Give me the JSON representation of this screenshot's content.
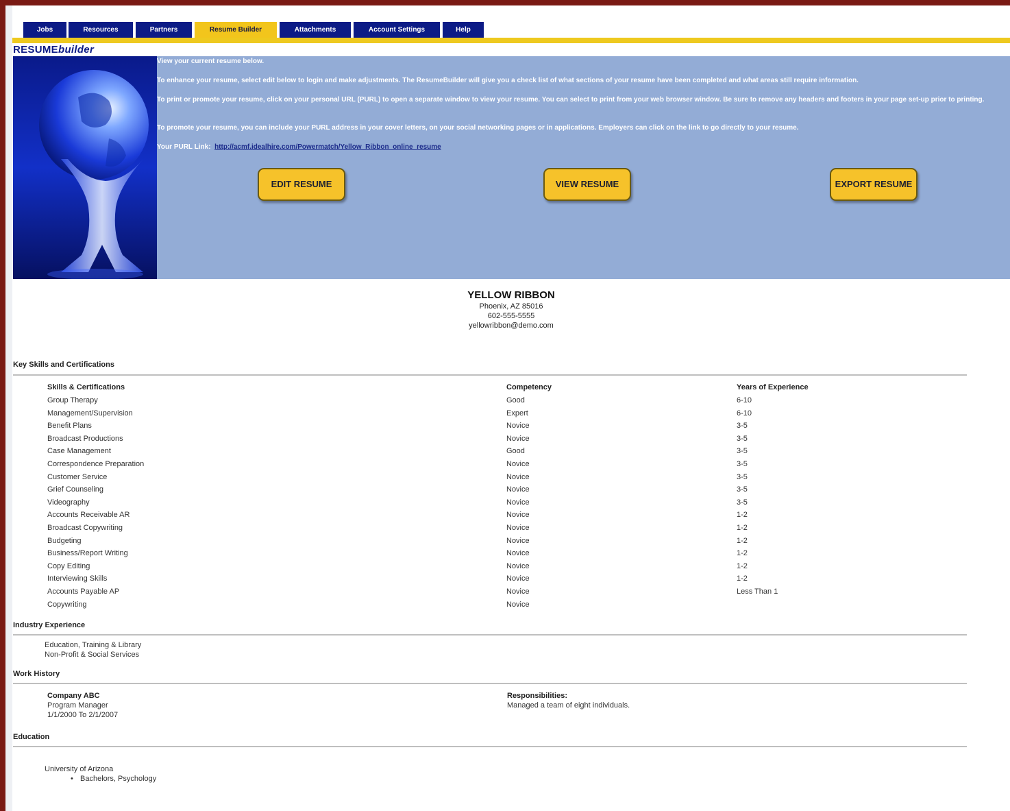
{
  "nav": {
    "tabs": [
      {
        "label": "Jobs"
      },
      {
        "label": "Resources"
      },
      {
        "label": "Partners"
      },
      {
        "label": "Resume Builder",
        "active": true
      },
      {
        "label": "Attachments"
      },
      {
        "label": "Account Settings"
      },
      {
        "label": "Help"
      }
    ]
  },
  "logo": {
    "resume": "RESUME",
    "builder": "builder"
  },
  "hero": {
    "p1": "View your current resume below.",
    "p2": "To enhance your resume, select edit below to login and make adjustments. The ResumeBuilder will give you a check list of what sections of your resume have been completed and what areas still require information.",
    "p3": "To print or promote your resume, click on your personal URL (PURL) to open a separate window to view your resume. You can select to print from your web browser window. Be sure to remove any headers and footers in your page set-up prior to printing.",
    "p4": "To promote your resume, you can include your PURL address in your cover letters, on your social networking pages or in applications. Employers can click on the link to go directly to your resume.",
    "purl_label": "Your PURL Link:",
    "purl_url": "http://acmf.idealhire.com/Powermatch/Yellow_Ribbon_online_resume",
    "buttons": {
      "edit": "EDIT RESUME",
      "view": "VIEW RESUME",
      "export": "EXPORT RESUME"
    }
  },
  "resume": {
    "name": "YELLOW RIBBON",
    "location": "Phoenix, AZ 85016",
    "phone": "602-555-5555",
    "email": "yellowribbon@demo.com"
  },
  "skills": {
    "title": "Key Skills and Certifications",
    "headers": {
      "skill": "Skills & Certifications",
      "competency": "Competency",
      "years": "Years of Experience"
    },
    "rows": [
      {
        "skill": "Group Therapy",
        "competency": "Good",
        "years": "6-10"
      },
      {
        "skill": "Management/Supervision",
        "competency": "Expert",
        "years": "6-10"
      },
      {
        "skill": "Benefit Plans",
        "competency": "Novice",
        "years": "3-5"
      },
      {
        "skill": "Broadcast Productions",
        "competency": "Novice",
        "years": "3-5"
      },
      {
        "skill": "Case Management",
        "competency": "Good",
        "years": "3-5"
      },
      {
        "skill": "Correspondence Preparation",
        "competency": "Novice",
        "years": "3-5"
      },
      {
        "skill": "Customer Service",
        "competency": "Novice",
        "years": "3-5"
      },
      {
        "skill": "Grief Counseling",
        "competency": "Novice",
        "years": "3-5"
      },
      {
        "skill": "Videography",
        "competency": "Novice",
        "years": "3-5"
      },
      {
        "skill": "Accounts Receivable AR",
        "competency": "Novice",
        "years": "1-2"
      },
      {
        "skill": "Broadcast Copywriting",
        "competency": "Novice",
        "years": "1-2"
      },
      {
        "skill": "Budgeting",
        "competency": "Novice",
        "years": "1-2"
      },
      {
        "skill": "Business/Report Writing",
        "competency": "Novice",
        "years": "1-2"
      },
      {
        "skill": "Copy Editing",
        "competency": "Novice",
        "years": "1-2"
      },
      {
        "skill": "Interviewing Skills",
        "competency": "Novice",
        "years": "1-2"
      },
      {
        "skill": "Accounts Payable AP",
        "competency": "Novice",
        "years": "Less Than 1"
      },
      {
        "skill": "Copywriting",
        "competency": "Novice",
        "years": ""
      }
    ]
  },
  "industry": {
    "title": "Industry Experience",
    "items": [
      "Education, Training & Library",
      "Non-Profit & Social Services"
    ]
  },
  "work": {
    "title": "Work History",
    "company": "Company ABC",
    "position": "Program Manager",
    "dates": "1/1/2000 To 2/1/2007",
    "resp_label": "Responsibilities:",
    "resp_text": "Managed a team of eight individuals."
  },
  "education": {
    "title": "Education",
    "school": "University of Arizona",
    "degree": "Bachelors, Psychology"
  },
  "colors": {
    "nav_tab": "#0c1b86",
    "nav_active": "#f2c51c",
    "hero_bg": "#93acd6",
    "button": "#f6c22a",
    "frame": "#7a1a14"
  }
}
